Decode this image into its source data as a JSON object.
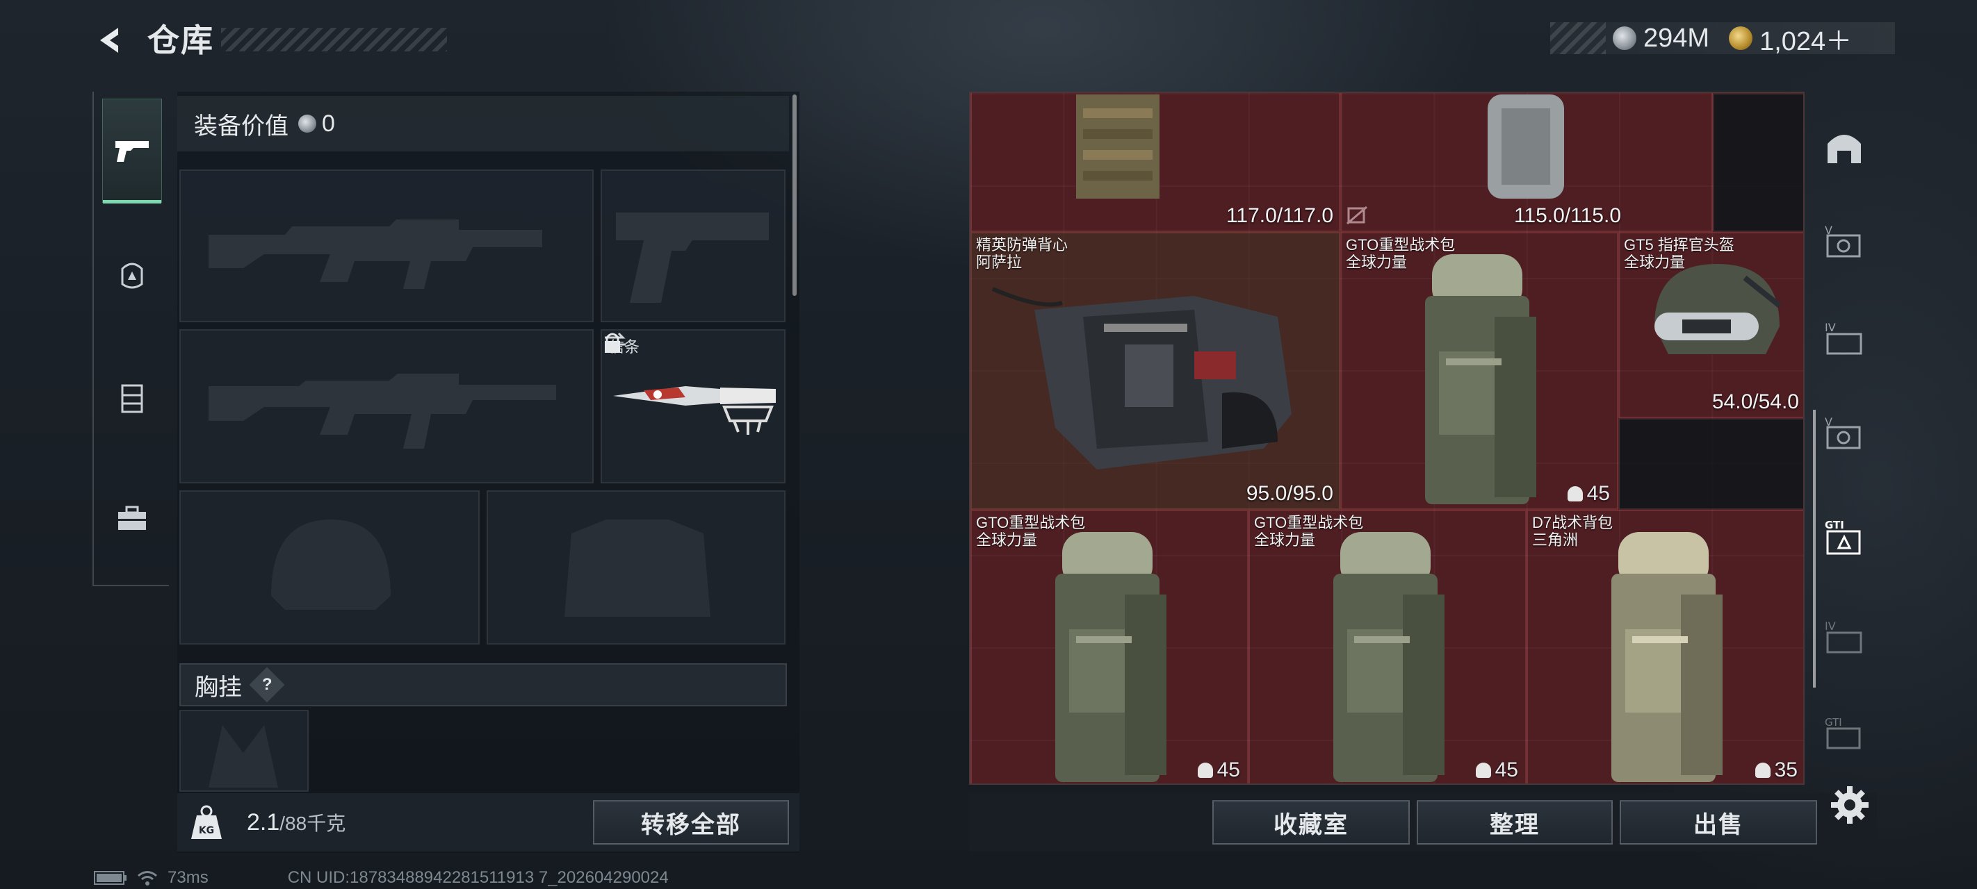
{
  "header": {
    "title": "仓库",
    "currency": [
      {
        "icon": "silver-coin-icon",
        "value": "294M"
      },
      {
        "icon": "gold-coin-icon",
        "value": "1,024＋"
      }
    ]
  },
  "left_nav": [
    "pistol-icon",
    "helmet-badge-icon",
    "vest-icon",
    "toolbox-icon"
  ],
  "loadout": {
    "value_label": "装备价值",
    "value": "0",
    "melee_slot_label": "信条",
    "chest_rig_label": "胸挂",
    "chest_rig_help": "?",
    "weight_current": "2.1",
    "weight_max": "/88千克",
    "transfer_all": "转移全部"
  },
  "stash": {
    "items": [
      {
        "name": "",
        "sub": "",
        "durability": "117.0/117.0"
      },
      {
        "name": "",
        "sub": "",
        "durability": "115.0/115.0"
      },
      {
        "name": "精英防弹背心",
        "sub": "阿萨拉",
        "durability": "95.0/95.0"
      },
      {
        "name": "GTO重型战术包",
        "sub": "全球力量",
        "capacity": "45"
      },
      {
        "name": "GT5 指挥官头盔",
        "sub": "全球力量",
        "durability": "54.0/54.0"
      },
      {
        "name": "GTO重型战术包",
        "sub": "全球力量",
        "capacity": "45"
      },
      {
        "name": "GTO重型战术包",
        "sub": "全球力量",
        "capacity": "45"
      },
      {
        "name": "D7战术背包",
        "sub": "三角洲",
        "capacity": "35"
      }
    ]
  },
  "right_nav": [
    "helmet-tab-icon",
    "v-tab-icon",
    "iv-tab-icon",
    "v-tab-2-icon",
    "gti-tab-icon",
    "iv-tab-2-icon",
    "gti-tab-2-icon"
  ],
  "buttons": {
    "collection": "收藏室",
    "organize": "整理",
    "sell": "出售"
  },
  "footer": {
    "ping": "73ms",
    "uid": "CN UID:18783488942281511913 7_202604290024"
  },
  "colors": {
    "accent": "#7ed9b0",
    "grid_bg": "#2b1215",
    "item_bg": "#6e2830"
  }
}
